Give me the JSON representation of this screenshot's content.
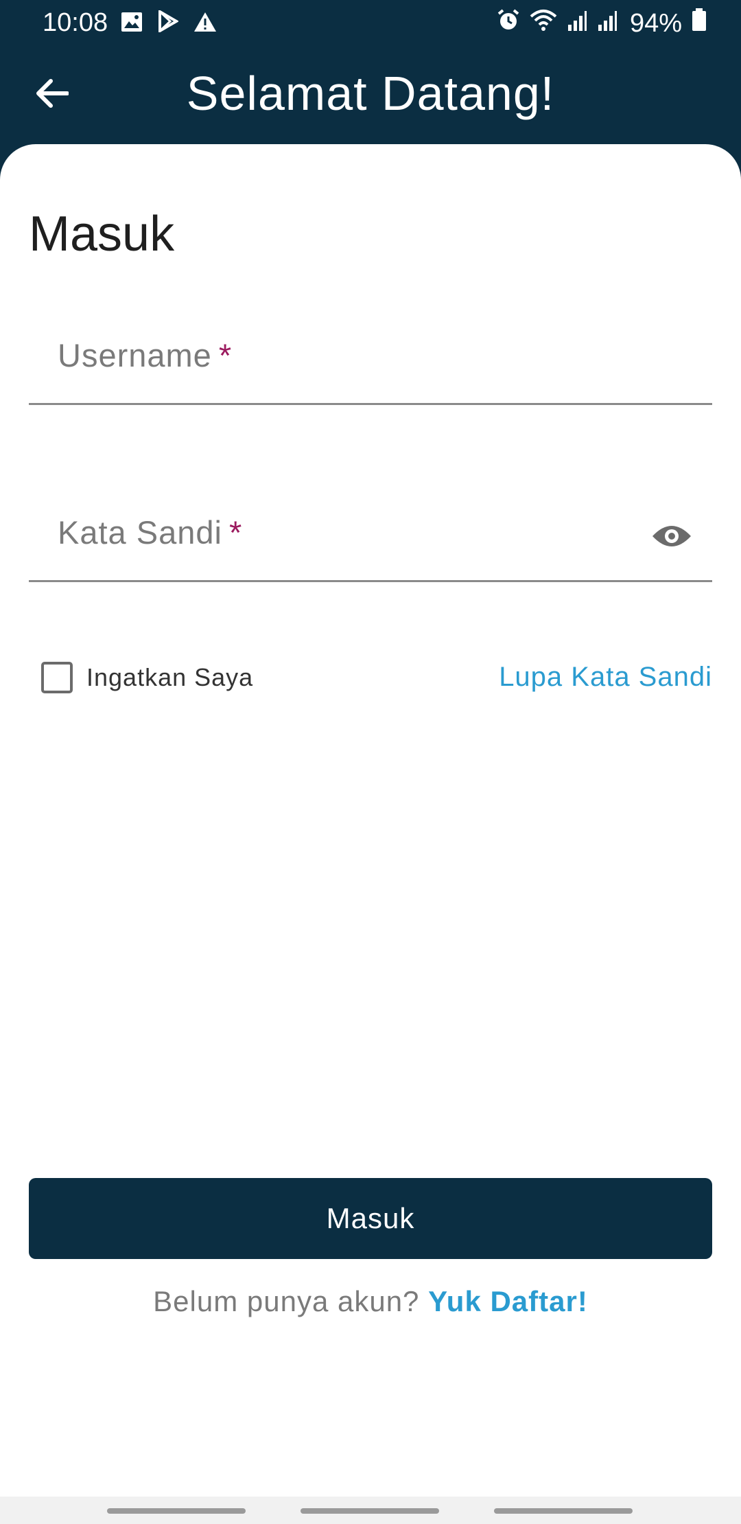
{
  "status_bar": {
    "time": "10:08",
    "battery": "94%",
    "left_icons": [
      "image-icon",
      "play-store-icon",
      "warning-icon"
    ],
    "right_icons": [
      "alarm-icon",
      "wifi-icon",
      "signal-icon",
      "signal-icon",
      "battery-icon"
    ]
  },
  "app_bar": {
    "title": "Selamat Datang!",
    "back_icon": "arrow-back-icon"
  },
  "login": {
    "heading": "Masuk",
    "username_label": "Username",
    "password_label": "Kata Sandi",
    "required_mark": "*",
    "remember_label": "Ingatkan Saya",
    "remember_checked": false,
    "forgot_link": "Lupa Kata Sandi",
    "submit_label": "Masuk",
    "signup_prompt": "Belum punya akun?",
    "signup_link": "Yuk Daftar!"
  },
  "colors": {
    "primary": "#0b2e42",
    "link": "#2a9bd0",
    "required": "#9b1a5e"
  }
}
